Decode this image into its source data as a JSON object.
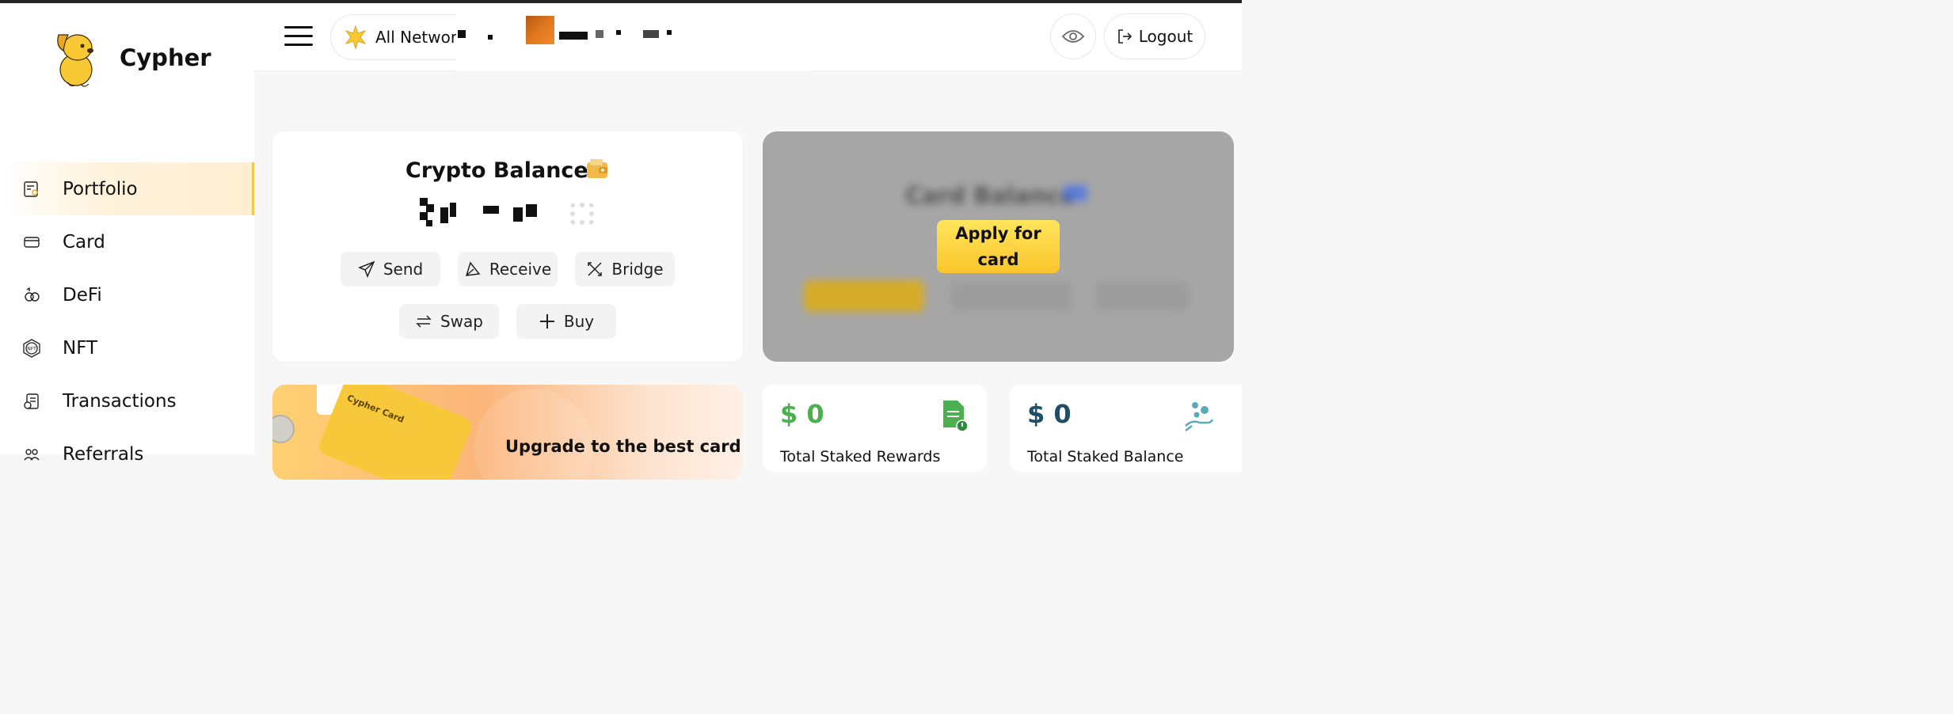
{
  "brand": {
    "name": "Cypher"
  },
  "sidebar": {
    "items": [
      {
        "label": "Portfolio",
        "icon": "portfolio-icon",
        "active": true
      },
      {
        "label": "Card",
        "icon": "card-icon",
        "active": false
      },
      {
        "label": "DeFi",
        "icon": "defi-icon",
        "active": false
      },
      {
        "label": "NFT",
        "icon": "nft-icon",
        "active": false
      },
      {
        "label": "Transactions",
        "icon": "transactions-icon",
        "active": false
      },
      {
        "label": "Referrals",
        "icon": "referrals-icon",
        "active": false
      }
    ]
  },
  "header": {
    "network_label": "All Networks",
    "logout_label": "Logout"
  },
  "balance": {
    "title": "Crypto Balance",
    "actions": {
      "send": "Send",
      "receive": "Receive",
      "bridge": "Bridge",
      "swap": "Swap",
      "buy": "Buy"
    }
  },
  "card_panel": {
    "title": "Card Balance",
    "apply_label": "Apply for card"
  },
  "promo": {
    "title": "Upgrade to the best card",
    "card_text": "Cypher Card"
  },
  "stats": [
    {
      "value": "$ 0",
      "label": "Total Staked Rewards",
      "color": "#4caf50"
    },
    {
      "value": "$ 0",
      "label": "Total Staked Balance",
      "color": "#1f4e66"
    }
  ],
  "colors": {
    "accent": "#f6c64b",
    "green": "#4caf50",
    "teal": "#5aa9b8"
  }
}
